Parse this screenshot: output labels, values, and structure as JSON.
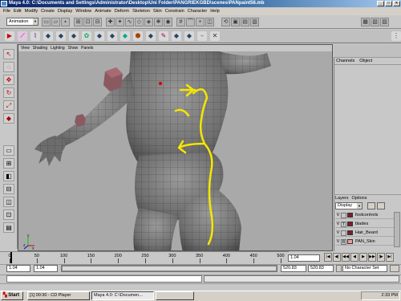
{
  "window": {
    "title": "Maya 4.0: C:\\Documents and Settings\\Administrator\\Desktop\\Uni Folder\\PANGRIEKGBD\\scenes\\PANpaint56.mb",
    "buttons": [
      "_",
      "□",
      "×"
    ]
  },
  "menubar": [
    "File",
    "Edit",
    "Modify",
    "Create",
    "Display",
    "Window",
    "Animate",
    "Deform",
    "Skeleton",
    "Skin",
    "Constrain",
    "Character",
    "Help"
  ],
  "mode_selector": {
    "value": "Animation"
  },
  "viewport": {
    "menu": [
      "View",
      "Shading",
      "Lighting",
      "Show",
      "Panels"
    ],
    "axis": {
      "x": "x",
      "y": "y",
      "z": "z"
    }
  },
  "channelbox": {
    "tabs": [
      "Channels",
      "Object"
    ]
  },
  "layers": {
    "header": [
      "Layers",
      "Options"
    ],
    "display_select": "Display",
    "rows": [
      {
        "visibility": "V",
        "type": "",
        "name": "footcontrols",
        "color": "#7a1f2a"
      },
      {
        "visibility": "V",
        "type": "T",
        "name": "blades",
        "color": "#7a1f2a"
      },
      {
        "visibility": "V",
        "type": "",
        "name": "Hair_Beard",
        "color": "#7a1f2a"
      },
      {
        "visibility": "V",
        "type": "R",
        "name": "PAN_Skin",
        "color": "#e8a0a0"
      }
    ]
  },
  "timeline": {
    "ticks": [
      "0",
      "50",
      "100",
      "150",
      "200",
      "250",
      "300",
      "350",
      "400",
      "450",
      "500"
    ],
    "current_time": "1.04"
  },
  "range": {
    "start": "1.04",
    "playback_start": "1.04",
    "playback_end": "520.83",
    "end": "520.83",
    "character_set": "No Character Set"
  },
  "taskbar": {
    "start": "Start",
    "tasks": [
      "[1] 00:30 - CD Player",
      "Maya 4.0: C:\\Documen...",
      ""
    ],
    "clock": "2:33 PM"
  },
  "colors": {
    "stroke": "#f5e600",
    "viewport_bg": "#a9a9a9"
  }
}
